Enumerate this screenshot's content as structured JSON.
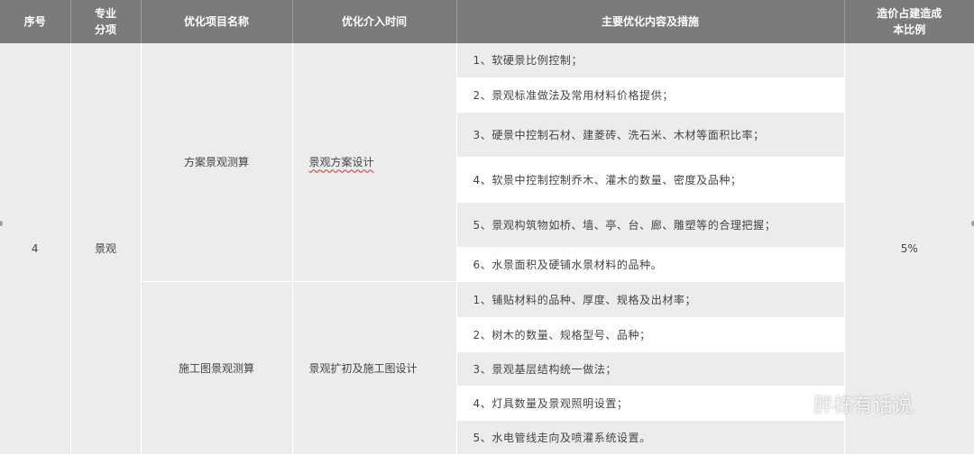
{
  "headers": {
    "seq": "序号",
    "category": "专业分项",
    "item_name": "优化项目名称",
    "timing": "优化介入时间",
    "measures": "主要优化内容及措施",
    "ratio": "造价占建造成本比例"
  },
  "row": {
    "seq": "4",
    "category": "景观",
    "ratio": "5%"
  },
  "groups": [
    {
      "name": "方案景观测算",
      "timing": "景观方案设计",
      "measures": [
        "1、软硬景比例控制；",
        "2、景观标准做法及常用材料价格提供；",
        "3、硬景中控制石材、建菱砖、洗石米、木材等面积比率；",
        "4、软景中控制控制乔木、灌木的数量、密度及品种；",
        "5、景观构筑物如桥、墙、亭、台、廊、雕塑等的合理把握；",
        "6、水景面积及硬铺水景材料的品种。"
      ]
    },
    {
      "name": "施工图景观测算",
      "timing": "景观扩初及施工图设计",
      "measures": [
        "1、铺贴材料的品种、厚度、规格及出材率；",
        "2、树木的数量、规格型号、品种；",
        "3、景观基层结构统一做法；",
        "4、灯具数量及景观照明设置；",
        "5、水电管线走向及喷灌系统设置。"
      ]
    }
  ],
  "watermark": {
    "icon": "wechat-icon",
    "text": "胖栋有话说"
  }
}
